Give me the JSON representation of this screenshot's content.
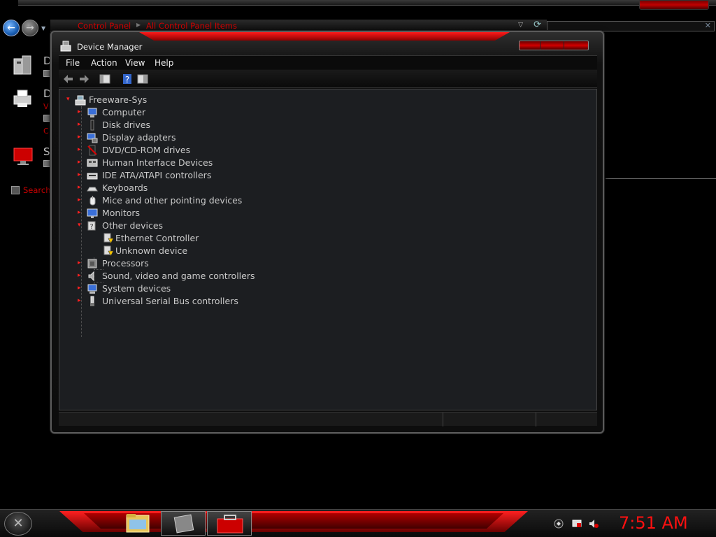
{
  "explorer": {
    "breadcrumb": [
      "Control Panel",
      "All Control Panel Items"
    ],
    "breadcrumb_sep": "▸",
    "left_items": [
      {
        "letter": "D",
        "subtext": ""
      },
      {
        "letter": "D",
        "subtext_top": "V",
        "subtext_bottom": "C"
      },
      {
        "letter": "S",
        "subtext": ""
      }
    ],
    "search_link": "Search"
  },
  "window": {
    "title": "Device Manager",
    "menu": [
      "File",
      "Action",
      "View",
      "Help"
    ]
  },
  "tree": {
    "root": "Freeware-Sys",
    "nodes": [
      {
        "label": "Computer",
        "icon": "computer-icon"
      },
      {
        "label": "Disk drives",
        "icon": "disk-icon"
      },
      {
        "label": "Display adapters",
        "icon": "display-adapter-icon"
      },
      {
        "label": "DVD/CD-ROM drives",
        "icon": "dvd-icon"
      },
      {
        "label": "Human Interface Devices",
        "icon": "hid-icon"
      },
      {
        "label": "IDE ATA/ATAPI controllers",
        "icon": "ide-icon"
      },
      {
        "label": "Keyboards",
        "icon": "keyboard-icon"
      },
      {
        "label": "Mice and other pointing devices",
        "icon": "mouse-icon"
      },
      {
        "label": "Monitors",
        "icon": "monitor-icon"
      },
      {
        "label": "Other devices",
        "icon": "unknown-device-icon",
        "expanded": true,
        "children": [
          {
            "label": "Ethernet Controller",
            "icon": "warning-device-icon"
          },
          {
            "label": "Unknown device",
            "icon": "warning-device-icon"
          }
        ]
      },
      {
        "label": "Processors",
        "icon": "processor-icon"
      },
      {
        "label": "Sound, video and game controllers",
        "icon": "speaker-icon"
      },
      {
        "label": "System devices",
        "icon": "system-icon"
      },
      {
        "label": "Universal Serial Bus controllers",
        "icon": "usb-icon"
      }
    ]
  },
  "taskbar": {
    "clock": "7:51 AM"
  },
  "colors": {
    "accent_red": "#ff1010",
    "tree_bg": "#1c1e21",
    "tree_text": "#c9c9c9"
  }
}
